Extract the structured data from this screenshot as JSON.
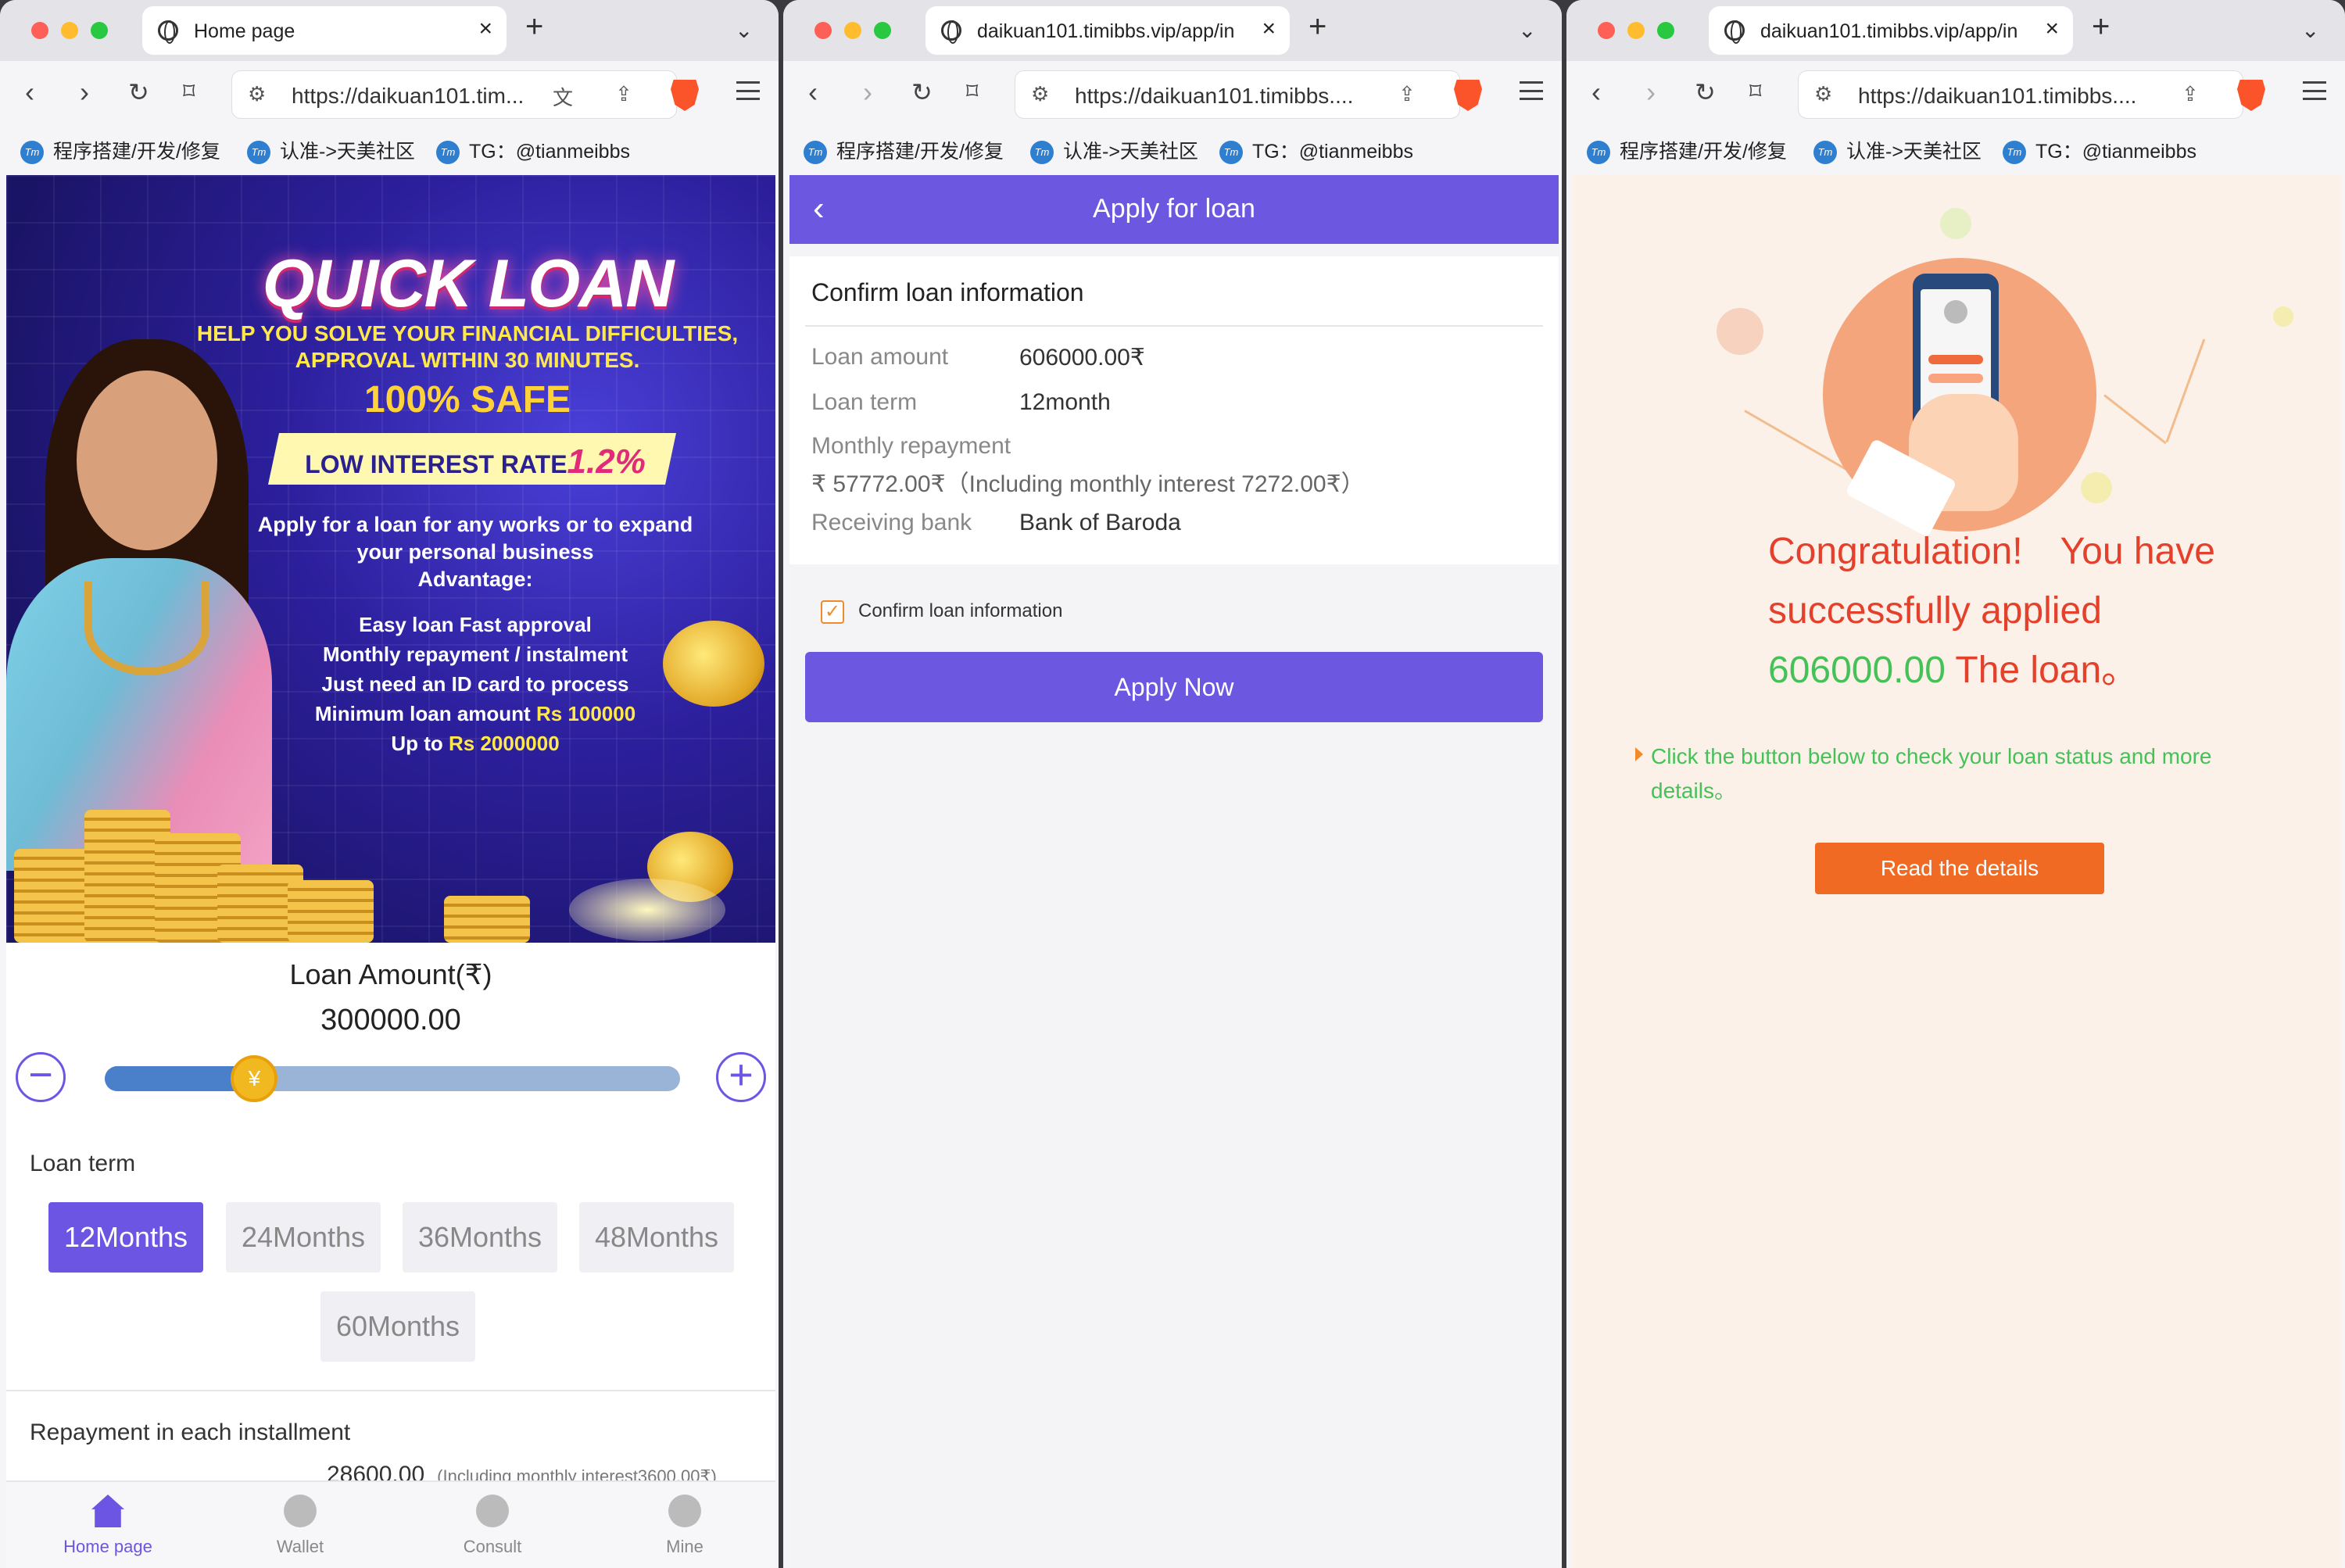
{
  "windows": [
    {
      "tab_title": "Home page",
      "url": "https://daikuan101.tim...",
      "bookmarks": [
        "程序搭建/开发/修复",
        "认准->天美社区",
        "TG：@tianmeibbs"
      ]
    },
    {
      "tab_title": "daikuan101.timibbs.vip/app/in",
      "url": "https://daikuan101.timibbs....",
      "bookmarks": [
        "程序搭建/开发/修复",
        "认准->天美社区",
        "TG：@tianmeibbs"
      ]
    },
    {
      "tab_title": "daikuan101.timibbs.vip/app/in",
      "url": "https://daikuan101.timibbs....",
      "bookmarks": [
        "程序搭建/开发/修复",
        "认准->天美社区",
        "TG：@tianmeibbs"
      ]
    }
  ],
  "home": {
    "banner": {
      "title": "QUICK LOAN",
      "subtitle_1": "HELP YOU SOLVE YOUR FINANCIAL DIFFICULTIES,",
      "subtitle_2": "APPROVAL WITHIN 30 MINUTES.",
      "safe": "100% SAFE",
      "rate_label": "LOW INTEREST RATE",
      "rate_value": "1.2%",
      "body_1": "Apply for a loan for any works or to expand",
      "body_2": "your personal business",
      "body_3": "Advantage:",
      "adv_1": "Easy loan Fast approval",
      "adv_2": "Monthly repayment / instalment",
      "adv_3": "Just need an ID card to process",
      "adv_4_prefix": "Minimum loan amount ",
      "adv_4_value": "Rs 100000",
      "adv_5_prefix": "Up to ",
      "adv_5_value": "Rs 2000000"
    },
    "amount_label": "Loan Amount(₹)",
    "amount_value": "300000.00",
    "slider_level": 0.26,
    "slider_thumb_glyph": "¥",
    "minus": "−",
    "plus": "+",
    "term_label": "Loan term",
    "terms": [
      "12Months",
      "24Months",
      "36Months",
      "48Months",
      "60Months"
    ],
    "selected_term": "12Months",
    "repayment_label": "Repayment in each installment",
    "repayment_value": "28600.00",
    "repayment_note": "(Including monthly interest3600.00₹)",
    "nav": [
      "Home page",
      "Wallet",
      "Consult",
      "Mine"
    ]
  },
  "apply": {
    "back": "‹",
    "title": "Apply for loan",
    "card_title": "Confirm loan information",
    "loan_amount_label": "Loan amount",
    "loan_amount_value": "606000.00₹",
    "loan_term_label": "Loan term",
    "loan_term_value": "12month",
    "monthly_label": "Monthly repayment",
    "monthly_value": "₹ 57772.00₹（Including monthly interest 7272.00₹）",
    "bank_label": "Receiving bank",
    "bank_value": "Bank of Baroda",
    "confirm_check": "✓",
    "confirm_label": "Confirm loan information",
    "button": "Apply Now"
  },
  "success": {
    "line_1": "Congratulation!　You have",
    "line_2": "successfully applied",
    "amount": "606000.00",
    "line_3_suffix": " The loan。",
    "note": "Click the button below to check your loan status and more details。",
    "button": "Read the details"
  },
  "colors": {
    "accent": "#6b57e0",
    "orange": "#f06a23",
    "success_green": "#46c158",
    "error_red": "#e4412c"
  }
}
